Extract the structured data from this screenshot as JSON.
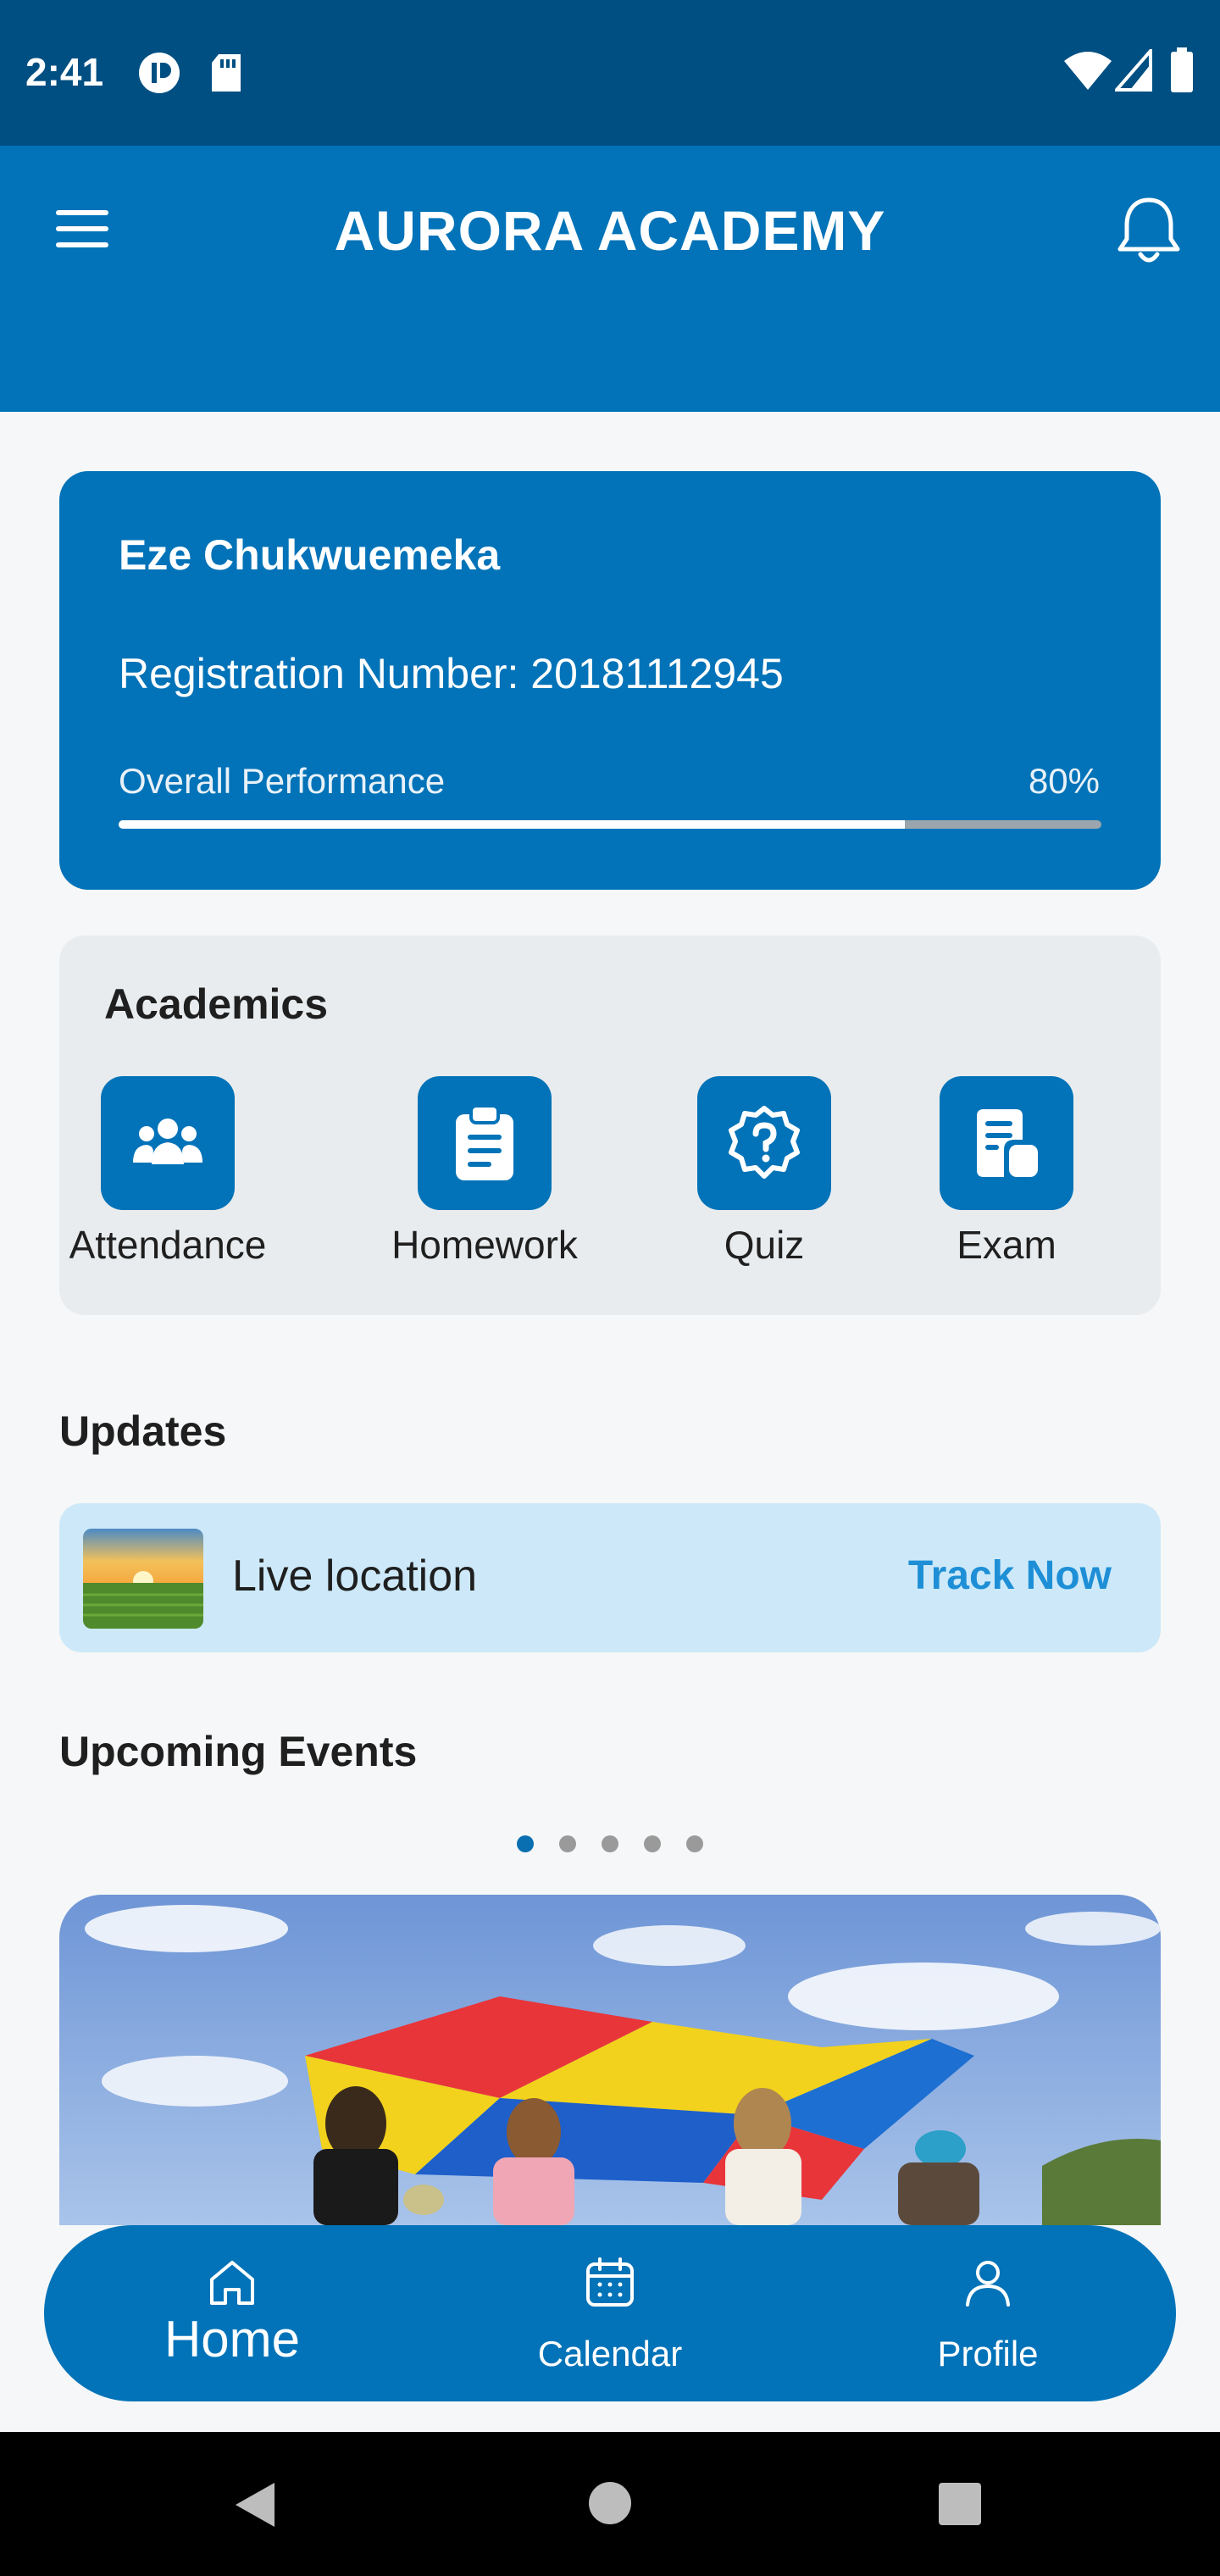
{
  "status_bar": {
    "time": "2:41"
  },
  "app_bar": {
    "title": "AURORA ACADEMY"
  },
  "student": {
    "name": "Eze Chukwuemeka",
    "registration_text": "Registration Number: 20181112945",
    "performance_label": "Overall Performance",
    "performance_value_text": "80%",
    "performance_fraction": 0.8
  },
  "academics": {
    "title": "Academics",
    "items": [
      {
        "label": "Attendance",
        "icon": "group-icon"
      },
      {
        "label": "Homework",
        "icon": "clipboard-icon"
      },
      {
        "label": "Quiz",
        "icon": "question-badge-icon"
      },
      {
        "label": "Exam",
        "icon": "document-icon"
      }
    ]
  },
  "updates": {
    "title": "Updates",
    "item_label": "Live location",
    "action_label": "Track Now"
  },
  "events": {
    "title": "Upcoming Events",
    "page_count": 5,
    "active_index": 0
  },
  "bottom_nav": {
    "items": [
      {
        "label": "Home",
        "icon": "home-icon",
        "active": true
      },
      {
        "label": "Calendar",
        "icon": "calendar-icon",
        "active": false
      },
      {
        "label": "Profile",
        "icon": "person-icon",
        "active": false
      }
    ]
  },
  "colors": {
    "primary": "#0273b8",
    "status_bar": "#004f82",
    "card_gray": "#e9ecee",
    "update_bg": "#cde9f9",
    "link": "#1e8fd6"
  }
}
